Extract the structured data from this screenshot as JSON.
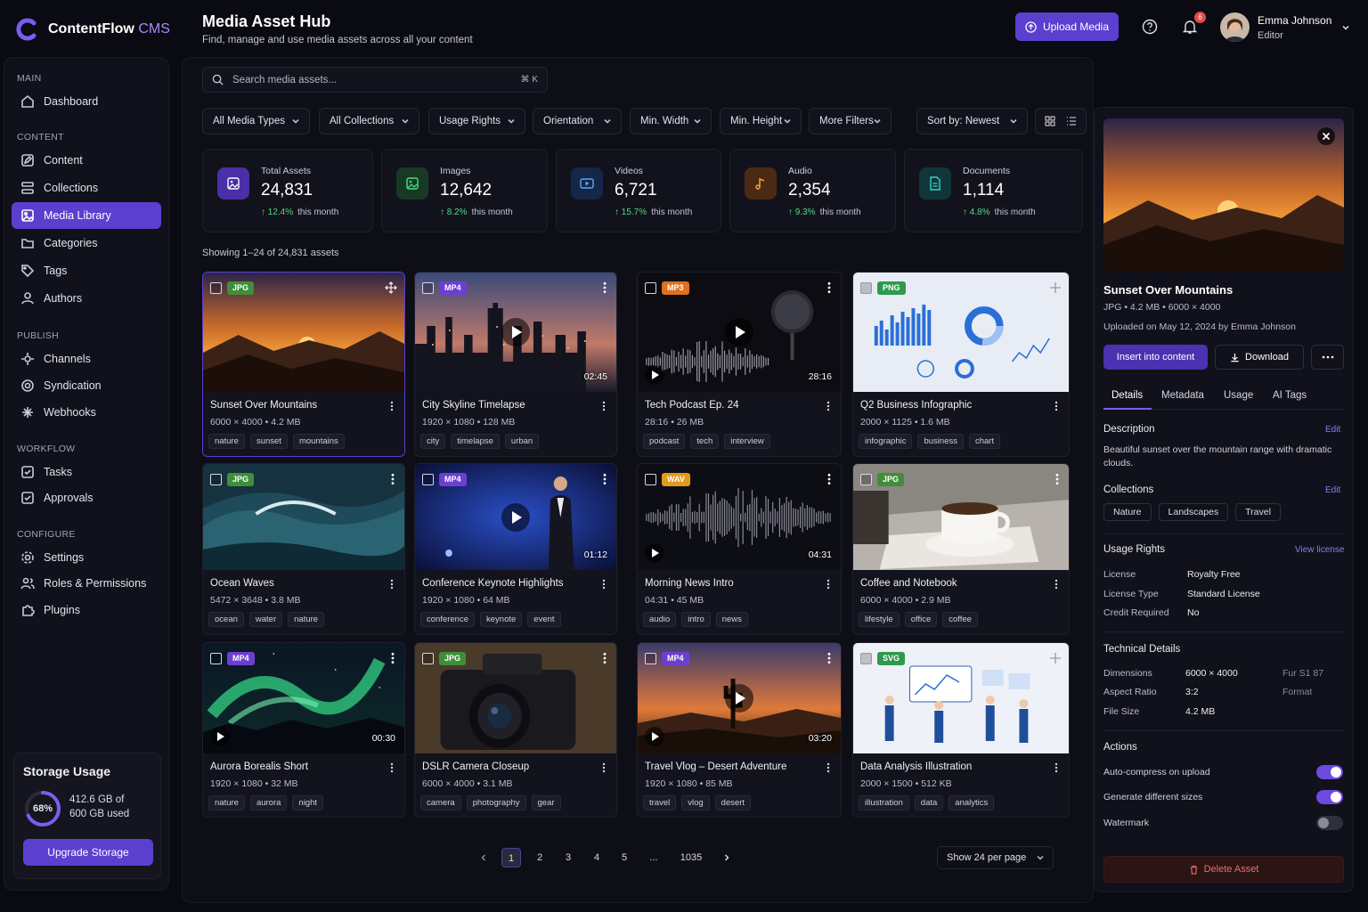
{
  "brand": {
    "name": "ContentFlow",
    "suffix": "CMS"
  },
  "sidebar": {
    "sections": {
      "main": "MAIN",
      "content": "CONTENT",
      "publish": "PUBLISH",
      "workflow": "WORKFLOW",
      "configure": "CONFIGURE"
    },
    "items": {
      "dashboard": "Dashboard",
      "content": "Content",
      "collections": "Collections",
      "media": "Media Library",
      "categories": "Categories",
      "tags": "Tags",
      "authors": "Authors",
      "channels": "Channels",
      "syndication": "Syndication",
      "webhooks": "Webhooks",
      "tasks": "Tasks",
      "approvals": "Approvals",
      "settings": "Settings",
      "roles": "Roles & Permissions",
      "plugins": "Plugins"
    },
    "storage": {
      "title": "Storage Usage",
      "percent": "68%",
      "percent_value": 0.68,
      "used": "412.6 GB of",
      "total": "600 GB used",
      "button": "Upgrade Storage"
    }
  },
  "header": {
    "title": "Media Asset Hub",
    "subtitle": "Find, manage and use media assets across all your content",
    "upload": "Upload Media",
    "notifications": "6",
    "user": {
      "name": "Emma Johnson",
      "role": "Editor"
    }
  },
  "search": {
    "placeholder": "Search media assets...",
    "shortcut": "⌘ K"
  },
  "filters": {
    "types": "All Media Types",
    "collections": "All Collections",
    "rights": "Usage Rights",
    "orientation": "Orientation",
    "minw": "Min. Width",
    "minh": "Min. Height",
    "more": "More Filters",
    "sort": "Sort by: Newest"
  },
  "stats": [
    {
      "label": "Total Assets",
      "value": "24,831",
      "change": "↑ 12.4%",
      "period": "this month"
    },
    {
      "label": "Images",
      "value": "12,642",
      "change": "↑ 8.2%",
      "period": "this month"
    },
    {
      "label": "Videos",
      "value": "6,721",
      "change": "↑ 15.7%",
      "period": "this month"
    },
    {
      "label": "Audio",
      "value": "2,354",
      "change": "↑ 9.3%",
      "period": "this month"
    },
    {
      "label": "Documents",
      "value": "1,114",
      "change": "↑ 4.8%",
      "period": "this month"
    }
  ],
  "showing": "Showing 1–24 of 24,831 assets",
  "assets": [
    {
      "format": "JPG",
      "title": "Sunset Over Mountains",
      "meta": "6000 × 4000  •  4.2 MB",
      "tags": [
        "nature",
        "sunset",
        "mountains"
      ]
    },
    {
      "format": "MP4",
      "title": "City Skyline Timelapse",
      "meta": "1920 × 1080  •  128 MB",
      "duration": "02:45",
      "tags": [
        "city",
        "timelapse",
        "urban"
      ]
    },
    {
      "format": "MP3",
      "title": "Tech Podcast Ep. 24",
      "meta": "28:16  •  26 MB",
      "duration": "28:16",
      "tags": [
        "podcast",
        "tech",
        "interview"
      ]
    },
    {
      "format": "PNG",
      "title": "Q2 Business Infographic",
      "meta": "2000 × 1125  •  1.6 MB",
      "tags": [
        "infographic",
        "business",
        "chart"
      ]
    },
    {
      "format": "JPG",
      "title": "Ocean Waves",
      "meta": "5472 × 3648  •  3.8 MB",
      "tags": [
        "ocean",
        "water",
        "nature"
      ]
    },
    {
      "format": "MP4",
      "title": "Conference Keynote Highlights",
      "meta": "1920 × 1080  •  64 MB",
      "duration": "01:12",
      "tags": [
        "conference",
        "keynote",
        "event"
      ]
    },
    {
      "format": "WAV",
      "title": "Morning News Intro",
      "meta": "04:31  •  45 MB",
      "duration": "04:31",
      "tags": [
        "audio",
        "intro",
        "news"
      ]
    },
    {
      "format": "JPG",
      "title": "Coffee and Notebook",
      "meta": "6000 × 4000  •  2.9 MB",
      "tags": [
        "lifestyle",
        "office",
        "coffee"
      ]
    },
    {
      "format": "MP4",
      "title": "Aurora Borealis Short",
      "meta": "1920 × 1080  •  32 MB",
      "duration": "00:30",
      "tags": [
        "nature",
        "aurora",
        "night"
      ]
    },
    {
      "format": "JPG",
      "title": "DSLR Camera Closeup",
      "meta": "6000 × 4000  •  3.1 MB",
      "tags": [
        "camera",
        "photography",
        "gear"
      ]
    },
    {
      "format": "MP4",
      "title": "Travel Vlog – Desert Adventure",
      "meta": "1920 × 1080  •  85 MB",
      "duration": "03:20",
      "tags": [
        "travel",
        "vlog",
        "desert"
      ]
    },
    {
      "format": "SVG",
      "title": "Data Analysis Illustration",
      "meta": "2000 × 1500  •  512 KB",
      "tags": [
        "illustration",
        "data",
        "analytics"
      ]
    }
  ],
  "pagination": {
    "pages": [
      "1",
      "2",
      "3",
      "4",
      "5",
      "...",
      "1035"
    ],
    "per_page": "Show 24 per page"
  },
  "detail": {
    "title": "Sunset Over Mountains",
    "meta": "JPG  •  4.2 MB  •  6000 × 4000",
    "uploaded": "Uploaded on May 12, 2024 by Emma Johnson",
    "insert": "Insert into content",
    "download": "Download",
    "tabs": [
      "Details",
      "Metadata",
      "Usage",
      "AI Tags"
    ],
    "description_label": "Description",
    "edit": "Edit",
    "description": "Beautiful sunset over the mountain range with dramatic clouds.",
    "collections_label": "Collections",
    "collections": [
      "Nature",
      "Landscapes",
      "Travel"
    ],
    "rights_label": "Usage Rights",
    "view_license": "View license",
    "license_label": "License",
    "license": "Royalty Free",
    "license_type_label": "License Type",
    "license_type": "Standard License",
    "credit_label": "Credit Required",
    "credit": "No",
    "tech_label": "Technical Details",
    "dimensions_label": "Dimensions",
    "dimensions": "6000 × 4000",
    "ratio_label": "Aspect Ratio",
    "ratio": "3:2",
    "size_label": "File Size",
    "size": "4.2 MB",
    "extra": "Fur S1 87",
    "format_label": "Format",
    "actions_label": "Actions",
    "action1": "Auto-compress on upload",
    "action2": "Generate different sizes",
    "action3": "Watermark",
    "delete": "Delete Asset"
  },
  "colors": {
    "accent": "#5b3fcf",
    "jpg": "#3f8f3a",
    "mp4": "#6d3fd1",
    "mp3": "#e0701f",
    "png": "#2f9a4e",
    "wav": "#e09a1f",
    "svg": "#2f9a4e"
  }
}
